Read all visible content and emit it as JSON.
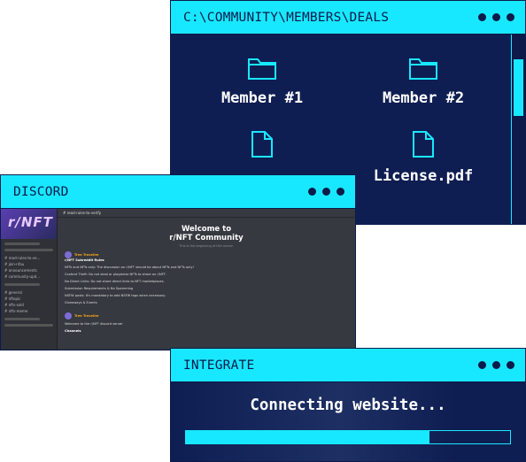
{
  "window_members": {
    "title": "C:\\COMMUNITY\\MEMBERS\\DEALS",
    "items": [
      {
        "label": "Member #1",
        "icon": "folder-icon"
      },
      {
        "label": "Member #2",
        "icon": "folder-icon"
      },
      {
        "label": "",
        "icon": "file-icon"
      },
      {
        "label": "License.pdf",
        "icon": "file-icon"
      }
    ]
  },
  "window_discord": {
    "title": "DISCORD",
    "topbar": "# read-rules-to-verify",
    "welcome_title": "Welcome to",
    "welcome_name": "r/NFT Community",
    "welcome_sub": "This is the beginning of this server.",
    "author": "Tree Traveller",
    "rules_title": "r/NFT Subreddit Rules",
    "rules": [
      "NFTs and NFTs only: The discussion on r/NFT should be about NFTs and NFTs only!",
      "Content Theft: Do not steal or plagiarize NFTs to share on r/NFT.",
      "No Direct Links: Do not share direct links to NFT marketplaces.",
      "Submission Requirements & No Spamming",
      "NSFW posts: It's mandatory to add NSFW tags when necessary.",
      "Giveaways & Events"
    ],
    "channels": [
      "# read-rules-to-ve...",
      "# join-nfau",
      "# announcements",
      "# community-upd...",
      "# general",
      "# nftopic",
      "# nfts-sold",
      "# nfts-meme"
    ],
    "footer_msg": "Welcome to the r/NFT discord server",
    "footer_heading": "Channels"
  },
  "window_integrate": {
    "title": "INTEGRATE",
    "status": "Connecting website...",
    "progress": 0.75
  },
  "colors": {
    "accent": "#18e8ff",
    "navy": "#0f1e52"
  }
}
